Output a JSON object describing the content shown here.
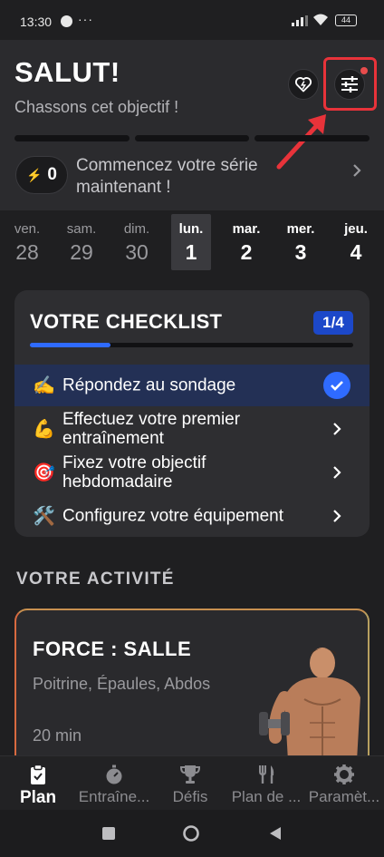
{
  "status_bar": {
    "time": "13:30",
    "dots": "···",
    "battery": "44"
  },
  "header": {
    "greeting": "SALUT!",
    "subtitle": "Chassons cet objectif !",
    "streak_count": "0",
    "streak_text": "Commencez votre série maintenant !"
  },
  "calendar": [
    {
      "day": "ven.",
      "date": "28"
    },
    {
      "day": "sam.",
      "date": "29"
    },
    {
      "day": "dim.",
      "date": "30"
    },
    {
      "day": "lun.",
      "date": "1"
    },
    {
      "day": "mar.",
      "date": "2"
    },
    {
      "day": "mer.",
      "date": "3"
    },
    {
      "day": "jeu.",
      "date": "4"
    }
  ],
  "checklist": {
    "title": "VOTRE CHECKLIST",
    "count": "1/4",
    "progress": 0.25,
    "items": [
      {
        "emoji": "✍️",
        "label": "Répondez au sondage",
        "done": true
      },
      {
        "emoji": "💪",
        "label": "Effectuez votre premier entraînement",
        "done": false
      },
      {
        "emoji": "🎯",
        "label": "Fixez votre objectif hebdomadaire",
        "done": false
      },
      {
        "emoji": "🛠️",
        "label": "Configurez votre équipement",
        "done": false
      }
    ]
  },
  "activity": {
    "heading": "VOTRE ACTIVITÉ",
    "card": {
      "title": "FORCE : SALLE",
      "muscles": "Poitrine, Épaules, Abdos",
      "duration": "20 min"
    }
  },
  "bottom_nav": [
    {
      "label": "Plan",
      "icon": "clipboard-icon",
      "active": true
    },
    {
      "label": "Entraîne...",
      "icon": "stopwatch-icon",
      "active": false
    },
    {
      "label": "Défis",
      "icon": "trophy-icon",
      "active": false
    },
    {
      "label": "Plan de ...",
      "icon": "fork-knife-icon",
      "active": false
    },
    {
      "label": "Paramèt...",
      "icon": "gear-icon",
      "active": false
    }
  ],
  "colors": {
    "accent": "#2f6bff",
    "highlight": "#e8333a",
    "background": "#1f1f21"
  }
}
